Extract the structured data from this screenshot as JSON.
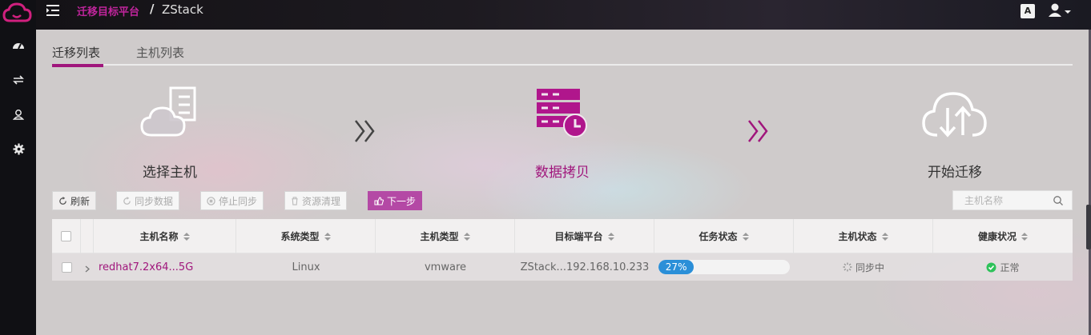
{
  "colors": {
    "accent": "#a0167c",
    "accent_light": "#b449a5",
    "progress": "#2b8fd8",
    "ok": "#2ec25a"
  },
  "breadcrumb": {
    "link": "迁移目标平台",
    "separator": "/",
    "current": "ZStack"
  },
  "topbar": {
    "lang_icon": "A"
  },
  "tabs": [
    {
      "label": "迁移列表",
      "active": true
    },
    {
      "label": "主机列表",
      "active": false
    }
  ],
  "steps": [
    {
      "label": "选择主机",
      "icon": "cloud-server-icon",
      "active": false
    },
    {
      "label": "数据拷贝",
      "icon": "server-clock-icon",
      "active": true
    },
    {
      "label": "开始迁移",
      "icon": "cloud-transfer-icon",
      "active": false
    }
  ],
  "toolbar": {
    "refresh": "刷新",
    "sync": "同步数据",
    "stop_sync": "停止同步",
    "cleanup": "资源清理",
    "next": "下一步"
  },
  "search": {
    "placeholder": "主机名称"
  },
  "table": {
    "columns": [
      "主机名称",
      "系统类型",
      "主机类型",
      "目标端平台",
      "任务状态",
      "主机状态",
      "健康状况"
    ],
    "rows": [
      {
        "name": "redhat7.2x64...5G",
        "os": "Linux",
        "type": "vmware",
        "target": "ZStack...192.168.10.233",
        "progress_label": "27%",
        "progress": 27,
        "host_status": "同步中",
        "health": "正常"
      }
    ]
  }
}
